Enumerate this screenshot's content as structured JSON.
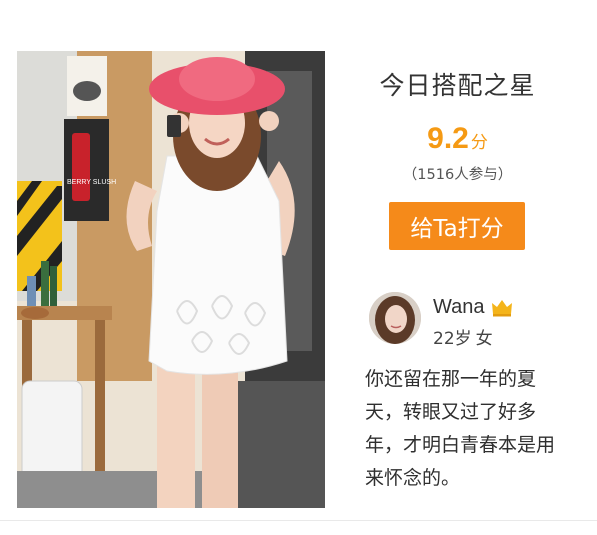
{
  "card": {
    "title": "今日搭配之星",
    "score": {
      "value": "9.2",
      "unit": "分"
    },
    "participants": "（1516人参与）",
    "rate_button_label": "给Ta打分",
    "photo_sign_text": "BERRY SLUSH"
  },
  "user": {
    "name": "Wana",
    "badge_icon": "crown-icon",
    "age": "22岁",
    "gender": "女"
  },
  "quote": "你还留在那一年的夏天，转眼又过了好多年，才明白青春本是用来怀念的。",
  "colors": {
    "accent_orange": "#f58a1a",
    "score_orange": "#f59a14",
    "crown_gold": "#f4b41a",
    "hat_pink": "#e8506b"
  }
}
